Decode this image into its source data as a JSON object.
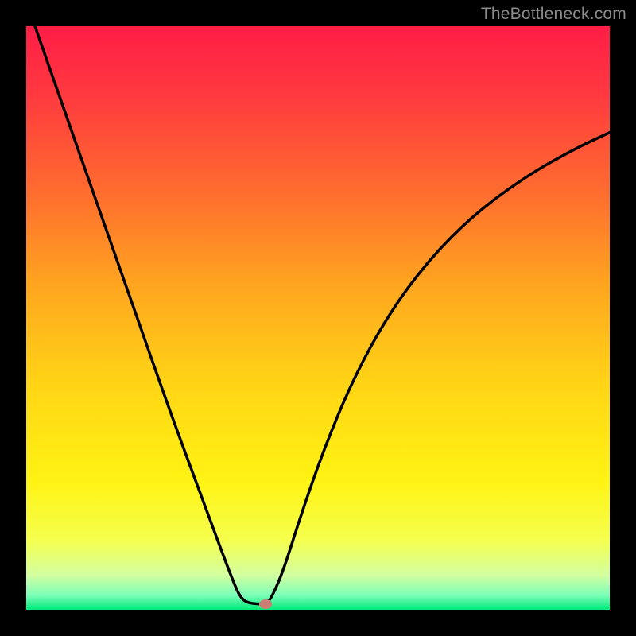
{
  "watermark": {
    "text": "TheBottleneck.com"
  },
  "chart_data": {
    "type": "line",
    "title": "",
    "xlabel": "",
    "ylabel": "",
    "x_range": [
      0,
      1
    ],
    "y_range": [
      0,
      1
    ],
    "background_gradient": {
      "type": "vertical",
      "stops": [
        {
          "pos": 0.0,
          "color": "#ff1d46"
        },
        {
          "pos": 0.12,
          "color": "#ff3a3f"
        },
        {
          "pos": 0.28,
          "color": "#ff6b2f"
        },
        {
          "pos": 0.45,
          "color": "#ffa71f"
        },
        {
          "pos": 0.62,
          "color": "#ffd615"
        },
        {
          "pos": 0.78,
          "color": "#fff314"
        },
        {
          "pos": 0.88,
          "color": "#f5ff4d"
        },
        {
          "pos": 0.94,
          "color": "#d4ffa0"
        },
        {
          "pos": 0.975,
          "color": "#7cffb8"
        },
        {
          "pos": 1.0,
          "color": "#00e97a"
        }
      ]
    },
    "series": [
      {
        "name": "bottleneck-curve",
        "color": "#000000",
        "width": 3.5,
        "points": [
          {
            "x": 0.015,
            "y": 1.0
          },
          {
            "x": 0.05,
            "y": 0.9
          },
          {
            "x": 0.1,
            "y": 0.757
          },
          {
            "x": 0.15,
            "y": 0.615
          },
          {
            "x": 0.2,
            "y": 0.472
          },
          {
            "x": 0.25,
            "y": 0.33
          },
          {
            "x": 0.3,
            "y": 0.195
          },
          {
            "x": 0.335,
            "y": 0.1
          },
          {
            "x": 0.36,
            "y": 0.035
          },
          {
            "x": 0.37,
            "y": 0.018
          },
          {
            "x": 0.38,
            "y": 0.012
          },
          {
            "x": 0.395,
            "y": 0.01
          },
          {
            "x": 0.405,
            "y": 0.01
          },
          {
            "x": 0.412,
            "y": 0.012
          },
          {
            "x": 0.42,
            "y": 0.02
          },
          {
            "x": 0.44,
            "y": 0.065
          },
          {
            "x": 0.47,
            "y": 0.16
          },
          {
            "x": 0.51,
            "y": 0.275
          },
          {
            "x": 0.56,
            "y": 0.395
          },
          {
            "x": 0.62,
            "y": 0.505
          },
          {
            "x": 0.69,
            "y": 0.6
          },
          {
            "x": 0.77,
            "y": 0.68
          },
          {
            "x": 0.86,
            "y": 0.745
          },
          {
            "x": 0.94,
            "y": 0.79
          },
          {
            "x": 1.0,
            "y": 0.818
          }
        ]
      }
    ],
    "marker": {
      "x": 0.41,
      "y": 0.01,
      "color": "#cb7f74"
    }
  }
}
